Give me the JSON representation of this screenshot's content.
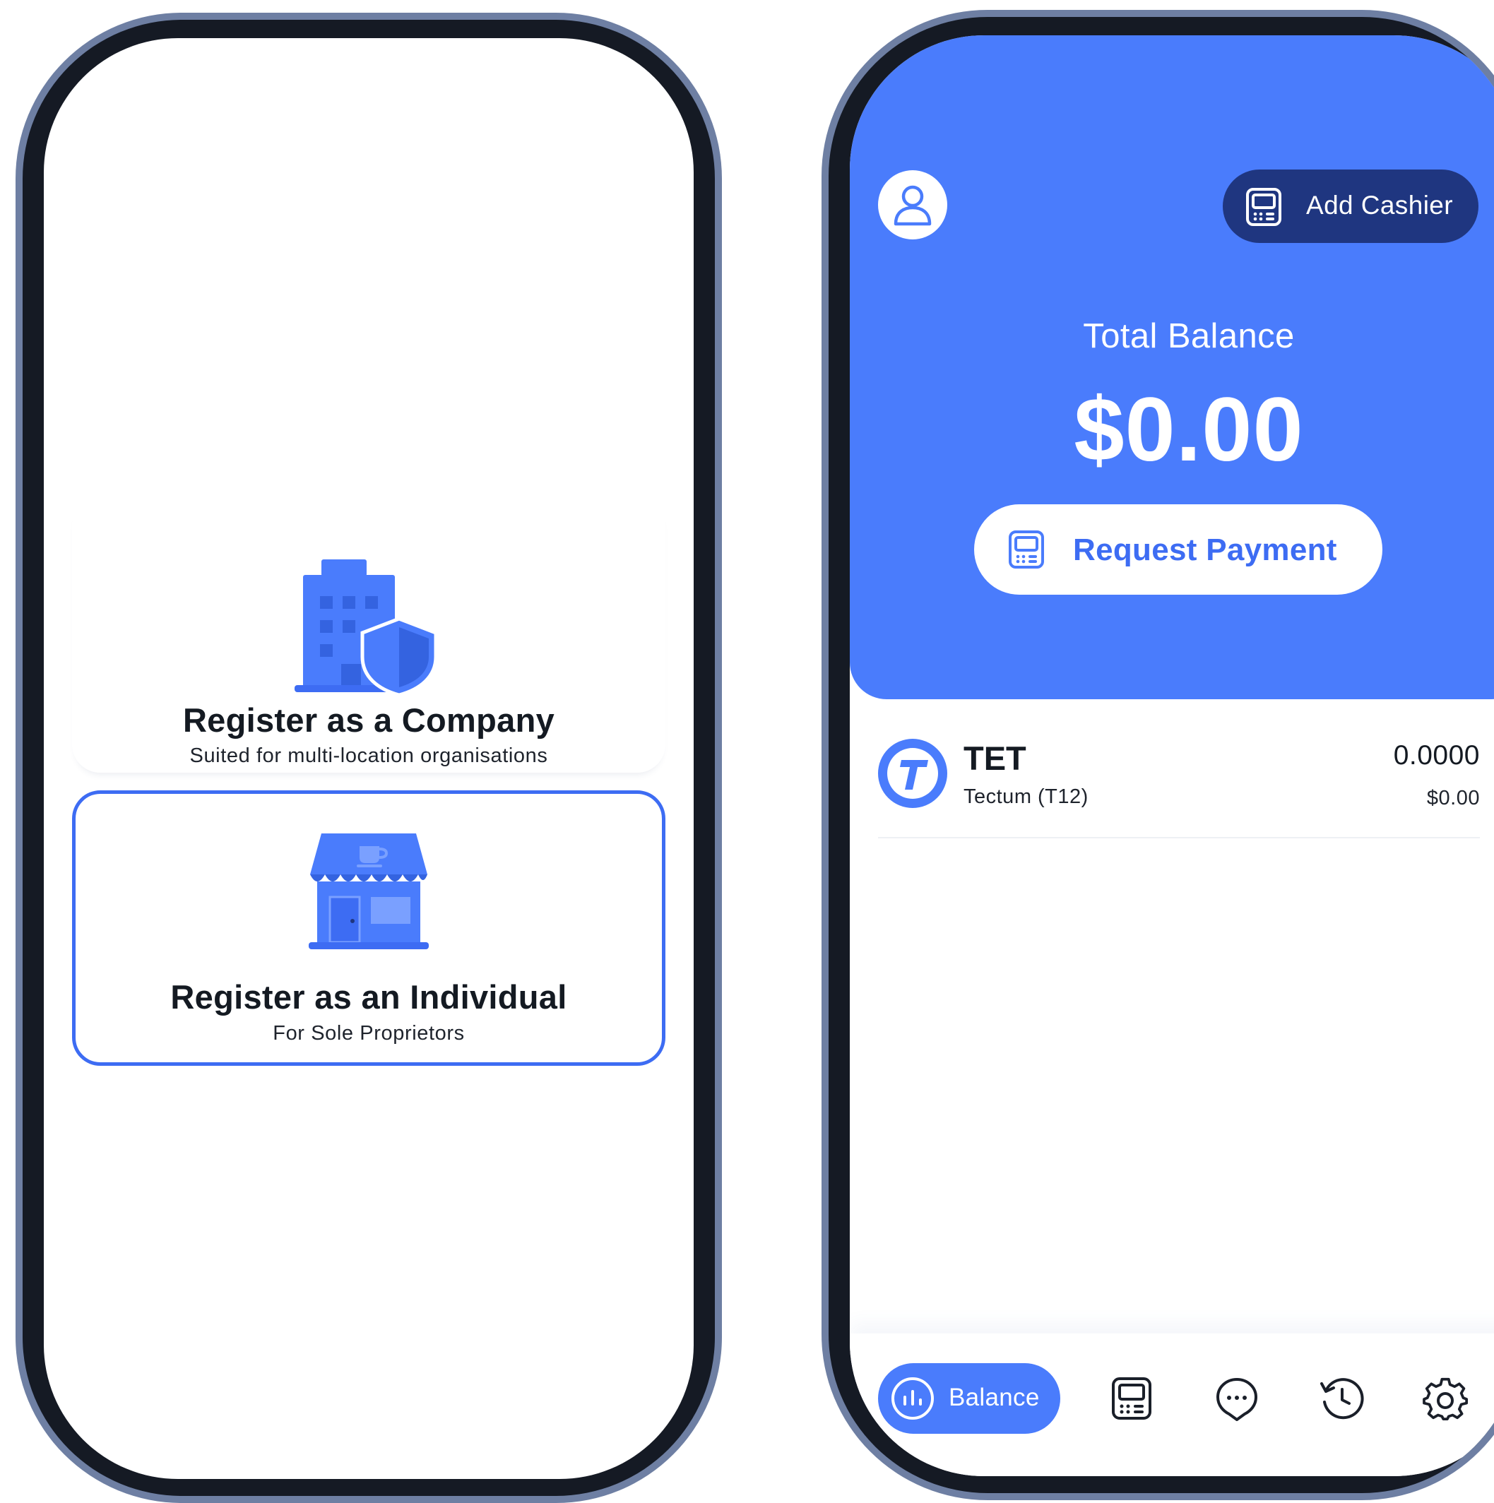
{
  "colors": {
    "accent": "#4a7cfc",
    "accent_text": "#3d6cf3",
    "navy": "#1f3680",
    "frame": "#6e7fa3",
    "bezel": "#151a24"
  },
  "registration": {
    "company": {
      "icon": "office-building-shield-icon",
      "title": "Register as a Company",
      "subtitle": "Suited for multi-location organisations"
    },
    "individual": {
      "icon": "storefront-icon",
      "title": "Register as an Individual",
      "subtitle": "For Sole Proprietors",
      "selected": true
    }
  },
  "wallet": {
    "header": {
      "avatar_icon": "user-icon",
      "add_cashier_icon": "pos-terminal-icon",
      "add_cashier_label": "Add Cashier"
    },
    "balance": {
      "label": "Total Balance",
      "value": "$0.00"
    },
    "request_payment": {
      "icon": "pos-terminal-icon",
      "label": "Request Payment"
    },
    "assets": [
      {
        "logo": "tectum-logo-icon",
        "symbol": "TET",
        "name": "Tectum (T12)",
        "amount": "0.0000",
        "fiat": "$0.00"
      }
    ],
    "nav": {
      "balance_label": "Balance",
      "items": [
        {
          "icon": "chart-icon",
          "label": "Balance",
          "active": true
        },
        {
          "icon": "pos-terminal-icon",
          "active": false
        },
        {
          "icon": "chat-icon",
          "active": false
        },
        {
          "icon": "history-icon",
          "active": false
        },
        {
          "icon": "gear-icon",
          "active": false
        }
      ]
    }
  }
}
